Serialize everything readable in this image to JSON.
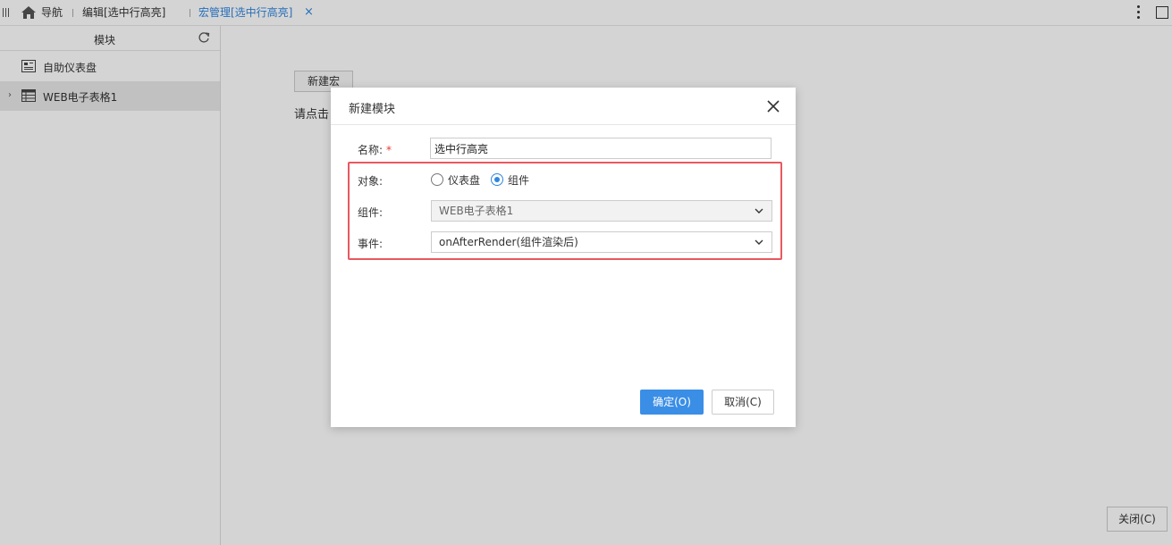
{
  "topbar": {
    "tabs": [
      {
        "label": "导航"
      },
      {
        "label": "编辑[选中行高亮]"
      },
      {
        "label": "宏管理[选中行高亮]",
        "active": true
      }
    ],
    "close_glyph": "×",
    "accent_color": "#2f86e0"
  },
  "sidebar": {
    "title": "模块",
    "items": [
      {
        "label": "自助仪表盘",
        "icon": "dashboard-icon",
        "expandable": false,
        "selected": false
      },
      {
        "label": "WEB电子表格1",
        "icon": "spreadsheet-icon",
        "expandable": true,
        "selected": true
      }
    ]
  },
  "main": {
    "new_macro_label": "新建宏",
    "hint_text": "请点击",
    "close_label": "关闭(C)"
  },
  "dialog": {
    "title": "新建模块",
    "name_label": "名称:",
    "required_mark": "*",
    "name_value": "选中行高亮",
    "target_label": "对象:",
    "radio_options": [
      {
        "label": "仪表盘",
        "checked": false
      },
      {
        "label": "组件",
        "checked": true
      }
    ],
    "component_label": "组件:",
    "component_value": "WEB电子表格1",
    "event_label": "事件:",
    "event_value": "onAfterRender(组件渲染后)",
    "ok_label": "确定(O)",
    "cancel_label": "取消(C)",
    "highlight_color": "#e8585f",
    "primary_color": "#3a8ee6"
  }
}
